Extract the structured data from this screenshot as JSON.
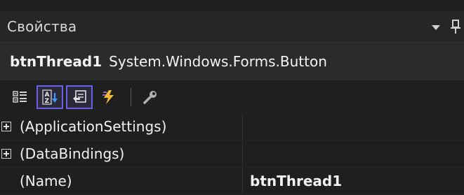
{
  "panel": {
    "title": "Свойства"
  },
  "object": {
    "name": "btnThread1",
    "type": "System.Windows.Forms.Button"
  },
  "toolbar": {
    "buttons": [
      {
        "icon": "categorized-icon",
        "selected": false
      },
      {
        "icon": "alphabetical-icon",
        "selected": true
      },
      {
        "icon": "properties-icon",
        "selected": true
      },
      {
        "icon": "events-icon",
        "selected": false
      },
      {
        "icon": "property-pages-icon",
        "selected": false
      }
    ]
  },
  "properties": [
    {
      "name": "(ApplicationSettings)",
      "value": "",
      "expandable": true
    },
    {
      "name": "(DataBindings)",
      "value": "",
      "expandable": true
    },
    {
      "name": "(Name)",
      "value": "btnThread1",
      "expandable": false
    }
  ],
  "colors": {
    "accent": "#6b5fe8",
    "background": "#1f1f1f",
    "header": "#262626"
  }
}
